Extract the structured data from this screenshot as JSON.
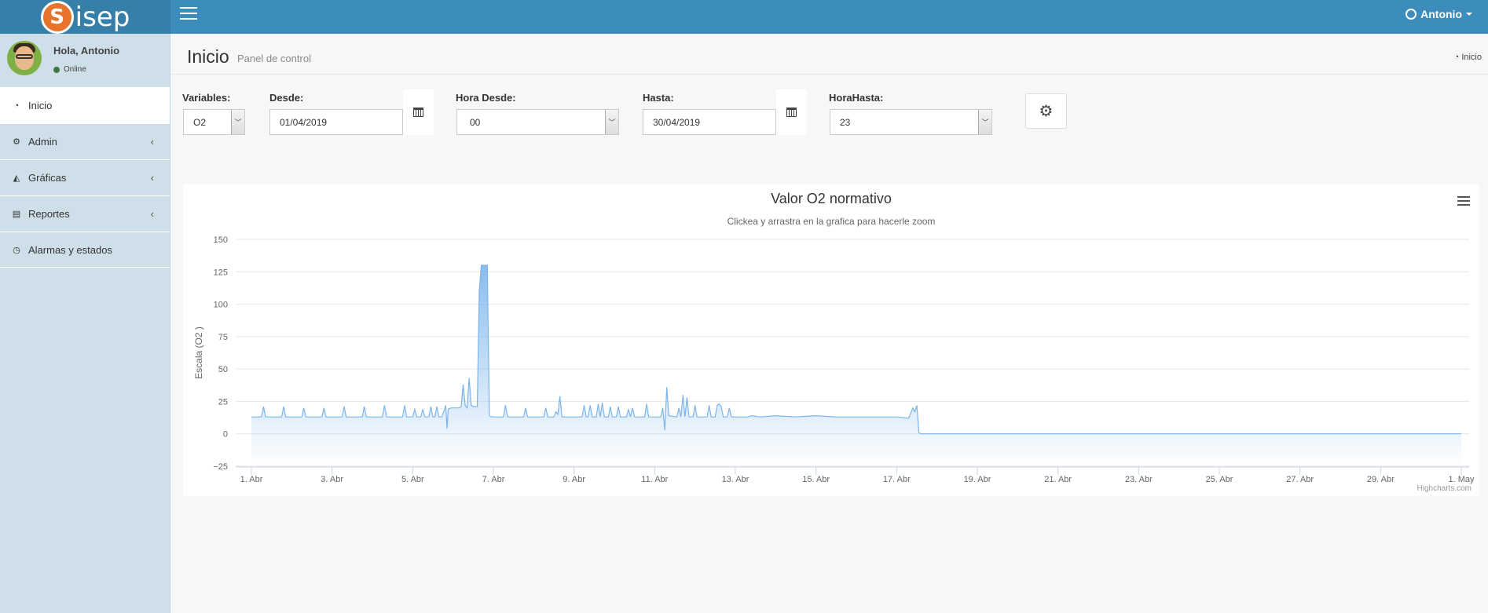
{
  "app": {
    "logo_letter": "S",
    "logo_text": "isep"
  },
  "user_menu": {
    "name": "Antonio"
  },
  "sidebar": {
    "greeting": "Hola, Antonio",
    "status": "Online",
    "items": [
      {
        "label": "Inicio",
        "icon": "dashboard-icon"
      },
      {
        "label": "Admin",
        "icon": "gears-icon"
      },
      {
        "label": "Gráficas",
        "icon": "area-chart-icon"
      },
      {
        "label": "Reportes",
        "icon": "file-excel-icon"
      },
      {
        "label": "Alarmas y estados",
        "icon": "clock-icon"
      }
    ]
  },
  "header": {
    "title": "Inicio",
    "subtitle": "Panel de control",
    "breadcrumb": "Inicio"
  },
  "filters": {
    "variables_label": "Variables:",
    "variables_value": "O2",
    "desde_label": "Desde:",
    "desde_value": "01/04/2019",
    "hora_desde_label": "Hora Desde:",
    "hora_desde_value": "00",
    "hasta_label": "Hasta:",
    "hasta_value": "30/04/2019",
    "hora_hasta_label": "HoraHasta:",
    "hora_hasta_value": "23"
  },
  "chart_data": {
    "type": "area",
    "title": "Valor O2 normativo",
    "subtitle": "Clickea y arrastra en la grafica para hacerle zoom",
    "ylabel": "Escala (O2 )",
    "xlabel": "",
    "ylim": [
      -25,
      150
    ],
    "yticks": [
      -25,
      0,
      25,
      50,
      75,
      100,
      125,
      150
    ],
    "x_domain_days": [
      1,
      31
    ],
    "xticks": [
      {
        "day": 1,
        "label": "1. Abr"
      },
      {
        "day": 3,
        "label": "3. Abr"
      },
      {
        "day": 5,
        "label": "5. Abr"
      },
      {
        "day": 7,
        "label": "7. Abr"
      },
      {
        "day": 9,
        "label": "9. Abr"
      },
      {
        "day": 11,
        "label": "11. Abr"
      },
      {
        "day": 13,
        "label": "13. Abr"
      },
      {
        "day": 15,
        "label": "15. Abr"
      },
      {
        "day": 17,
        "label": "17. Abr"
      },
      {
        "day": 19,
        "label": "19. Abr"
      },
      {
        "day": 21,
        "label": "21. Abr"
      },
      {
        "day": 23,
        "label": "23. Abr"
      },
      {
        "day": 25,
        "label": "25. Abr"
      },
      {
        "day": 27,
        "label": "27. Abr"
      },
      {
        "day": 29,
        "label": "29. Abr"
      },
      {
        "day": 31,
        "label": "1. May"
      }
    ],
    "grid": true,
    "legend": false,
    "color": "#7cb5ec",
    "credits": "Highcharts.com",
    "series": [
      {
        "points": [
          [
            1.0,
            13
          ],
          [
            1.25,
            13
          ],
          [
            1.3,
            21
          ],
          [
            1.35,
            13
          ],
          [
            1.75,
            13
          ],
          [
            1.8,
            21
          ],
          [
            1.85,
            13
          ],
          [
            2.25,
            13
          ],
          [
            2.3,
            20
          ],
          [
            2.35,
            13
          ],
          [
            2.75,
            13
          ],
          [
            2.8,
            20
          ],
          [
            2.85,
            13
          ],
          [
            3.25,
            13
          ],
          [
            3.3,
            21
          ],
          [
            3.35,
            13
          ],
          [
            3.75,
            13
          ],
          [
            3.8,
            21
          ],
          [
            3.85,
            13
          ],
          [
            4.25,
            13
          ],
          [
            4.3,
            22
          ],
          [
            4.35,
            13
          ],
          [
            4.75,
            13
          ],
          [
            4.8,
            22
          ],
          [
            4.85,
            13
          ],
          [
            5.0,
            13
          ],
          [
            5.05,
            19
          ],
          [
            5.1,
            13
          ],
          [
            5.2,
            13
          ],
          [
            5.25,
            19
          ],
          [
            5.3,
            13
          ],
          [
            5.4,
            13
          ],
          [
            5.45,
            21
          ],
          [
            5.5,
            13
          ],
          [
            5.55,
            13
          ],
          [
            5.6,
            21
          ],
          [
            5.65,
            13
          ],
          [
            5.72,
            13
          ],
          [
            5.78,
            18
          ],
          [
            5.82,
            22
          ],
          [
            5.85,
            4
          ],
          [
            5.88,
            19
          ],
          [
            5.95,
            20
          ],
          [
            6.15,
            20
          ],
          [
            6.2,
            21
          ],
          [
            6.25,
            38
          ],
          [
            6.3,
            22
          ],
          [
            6.35,
            20
          ],
          [
            6.4,
            43
          ],
          [
            6.45,
            22
          ],
          [
            6.5,
            21
          ],
          [
            6.6,
            21
          ],
          [
            6.65,
            110
          ],
          [
            6.7,
            130
          ],
          [
            6.85,
            130
          ],
          [
            6.9,
            14
          ],
          [
            6.95,
            13
          ],
          [
            7.25,
            13
          ],
          [
            7.3,
            22
          ],
          [
            7.35,
            13
          ],
          [
            7.75,
            13
          ],
          [
            7.8,
            20
          ],
          [
            7.85,
            13
          ],
          [
            8.25,
            13
          ],
          [
            8.3,
            20
          ],
          [
            8.35,
            13
          ],
          [
            8.5,
            13
          ],
          [
            8.55,
            17
          ],
          [
            8.6,
            15
          ],
          [
            8.65,
            29
          ],
          [
            8.7,
            13
          ],
          [
            9.2,
            13
          ],
          [
            9.25,
            22
          ],
          [
            9.3,
            13
          ],
          [
            9.35,
            13
          ],
          [
            9.4,
            22
          ],
          [
            9.45,
            13
          ],
          [
            9.55,
            13
          ],
          [
            9.6,
            23
          ],
          [
            9.65,
            13
          ],
          [
            9.7,
            24
          ],
          [
            9.75,
            13
          ],
          [
            9.85,
            13
          ],
          [
            9.9,
            21
          ],
          [
            9.95,
            13
          ],
          [
            10.05,
            13
          ],
          [
            10.1,
            21
          ],
          [
            10.15,
            13
          ],
          [
            10.3,
            13
          ],
          [
            10.35,
            19
          ],
          [
            10.4,
            13
          ],
          [
            10.45,
            20
          ],
          [
            10.5,
            13
          ],
          [
            10.75,
            13
          ],
          [
            10.8,
            23
          ],
          [
            10.85,
            13
          ],
          [
            11.15,
            13
          ],
          [
            11.2,
            20
          ],
          [
            11.25,
            3
          ],
          [
            11.3,
            36
          ],
          [
            11.35,
            14
          ],
          [
            11.55,
            13
          ],
          [
            11.6,
            20
          ],
          [
            11.65,
            13
          ],
          [
            11.7,
            30
          ],
          [
            11.75,
            13
          ],
          [
            11.8,
            28
          ],
          [
            11.85,
            13
          ],
          [
            11.95,
            13
          ],
          [
            12.0,
            22
          ],
          [
            12.05,
            13
          ],
          [
            12.3,
            13
          ],
          [
            12.35,
            22
          ],
          [
            12.4,
            13
          ],
          [
            12.5,
            13
          ],
          [
            12.55,
            22
          ],
          [
            12.6,
            23
          ],
          [
            12.65,
            21
          ],
          [
            12.7,
            13
          ],
          [
            12.8,
            13
          ],
          [
            12.85,
            20
          ],
          [
            12.9,
            13
          ],
          [
            13.3,
            13
          ],
          [
            13.4,
            14
          ],
          [
            13.6,
            13
          ],
          [
            14.0,
            14
          ],
          [
            14.5,
            13
          ],
          [
            15.0,
            14
          ],
          [
            15.5,
            13
          ],
          [
            16.0,
            13
          ],
          [
            16.5,
            13
          ],
          [
            17.0,
            13
          ],
          [
            17.3,
            12
          ],
          [
            17.4,
            20
          ],
          [
            17.45,
            17
          ],
          [
            17.5,
            22
          ],
          [
            17.55,
            1
          ],
          [
            17.6,
            0
          ],
          [
            18.5,
            0
          ],
          [
            31.0,
            0
          ]
        ]
      }
    ]
  }
}
